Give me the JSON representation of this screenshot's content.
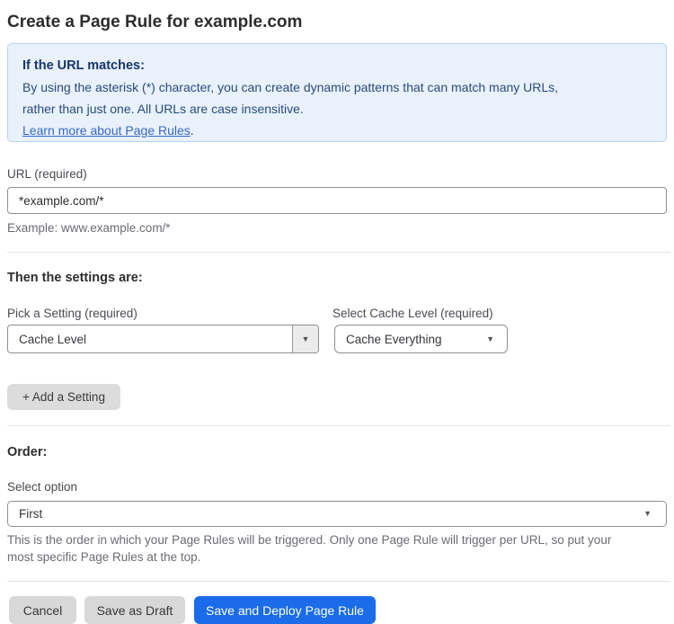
{
  "page": {
    "title": "Create a Page Rule for example.com"
  },
  "info_box": {
    "heading": "If the URL matches:",
    "body_line1": "By using the asterisk (*) character, you can create dynamic patterns that can match many URLs,",
    "body_line2": "rather than just one. All URLs are case insensitive.",
    "link_label": "Learn more about Page Rules",
    "link_suffix": "."
  },
  "url_field": {
    "label": "URL (required)",
    "value": "*example.com/*",
    "helper": "Example: www.example.com/*"
  },
  "settings_section": {
    "heading": "Then the settings are:",
    "setting_picker": {
      "label": "Pick a Setting (required)",
      "value": "Cache Level"
    },
    "cache_level_picker": {
      "label": "Select Cache Level (required)",
      "value": "Cache Everything"
    },
    "add_setting_label": "+ Add a Setting"
  },
  "order_section": {
    "heading": "Order:",
    "label": "Select option",
    "value": "First",
    "helper_line1": "This is the order in which your Page Rules will be triggered. Only one Page Rule will trigger per URL, so put your",
    "helper_line2": "most specific Page Rules at the top."
  },
  "actions": {
    "cancel_label": "Cancel",
    "save_draft_label": "Save as Draft",
    "save_deploy_label": "Save and Deploy Page Rule"
  },
  "icons": {
    "dropdown_arrow": "▼"
  },
  "colors": {
    "info_box_background": "#e8f1fc",
    "info_box_border": "#b7d3f2",
    "info_text": "#2b4a7e",
    "link_blue": "#3968c8",
    "primary_button_blue": "#1a6ce8",
    "secondary_button_gray": "#d8d8d8"
  }
}
